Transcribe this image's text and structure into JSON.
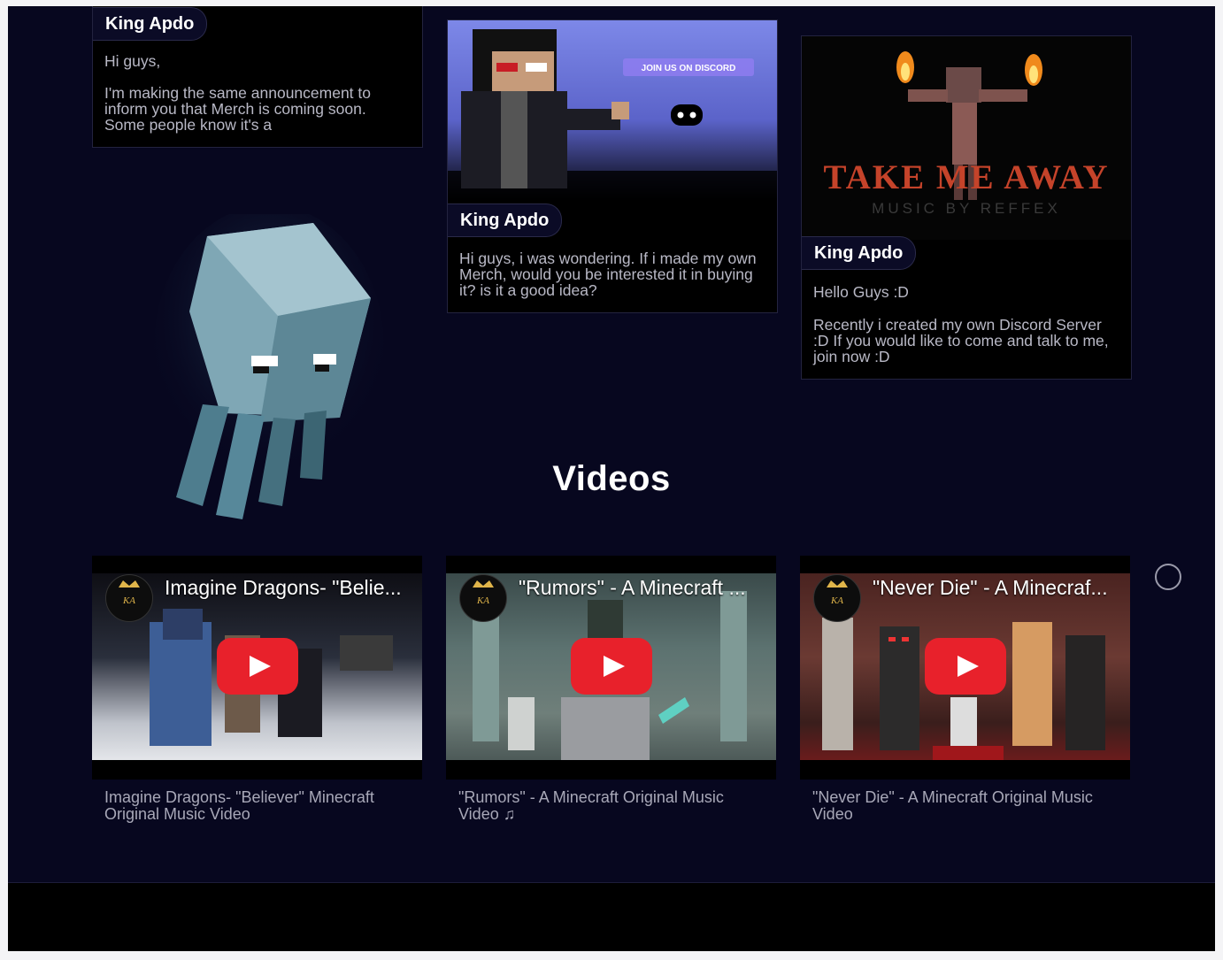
{
  "posts": [
    {
      "author": "King Apdo",
      "paragraphs": [
        "Hi guys,",
        "I'm making the same announcement to inform you that Merch is coming soon. Some people know it's a"
      ]
    },
    {
      "author": "King Apdo",
      "image_banner": "JOIN US ON DISCORD",
      "paragraphs": [
        "Hi guys, i was wondering. If i made my own Merch, would you be interested it in buying it? is it a good idea?"
      ]
    },
    {
      "author": "King Apdo",
      "image_title": "TAKE ME AWAY",
      "image_subtitle": "MUSIC BY REFFEX",
      "paragraphs": [
        "Hello Guys :D",
        "Recently i created my own Discord Server :D If you would like to come and talk to me, join now :D"
      ]
    }
  ],
  "videos": {
    "heading": "Videos",
    "items": [
      {
        "overlay_title": "Imagine Dragons- \"Belie...",
        "caption": "Imagine Dragons- \"Believer\" Minecraft Original Music Video"
      },
      {
        "overlay_title": "\"Rumors\" - A Minecraft ...",
        "caption": "\"Rumors\" - A Minecraft Original Music Video ♫"
      },
      {
        "overlay_title": "\"Never Die\" - A Minecraf...",
        "caption": "\"Never Die\" - A Minecraft Original Music Video"
      }
    ]
  },
  "colors": {
    "page_background": "#07071f",
    "card_background": "#000000",
    "play_button": "#e8212b",
    "footer": "#000000"
  },
  "icons": [
    "discord-icon",
    "play-icon",
    "crown-logo-icon",
    "squid-illustration",
    "scroll-indicator-icon"
  ]
}
